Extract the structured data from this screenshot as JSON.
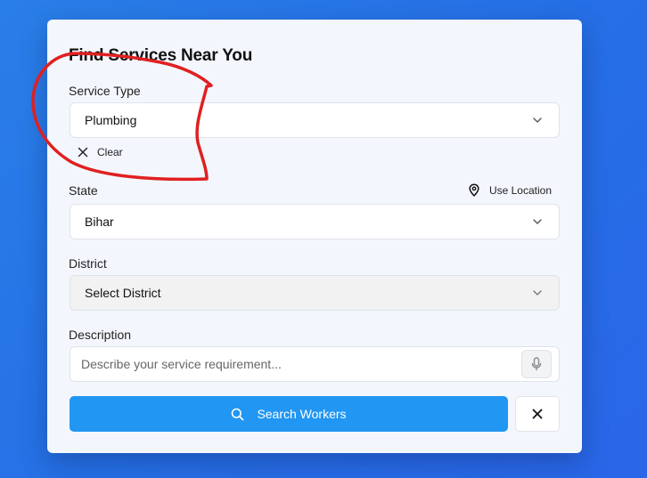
{
  "form": {
    "title": "Find Services Near You",
    "service_type": {
      "label": "Service Type",
      "value": "Plumbing",
      "clear_label": "Clear"
    },
    "state": {
      "label": "State",
      "value": "Bihar",
      "use_location_label": "Use Location"
    },
    "district": {
      "label": "District",
      "value": "Select District"
    },
    "description": {
      "label": "Description",
      "placeholder": "Describe your service requirement..."
    },
    "search_button_label": "Search Workers"
  },
  "icons": {
    "chevron": "chevron-down-icon",
    "clear": "close-icon",
    "location": "map-pin-icon",
    "mic": "microphone-icon",
    "search": "search-icon",
    "close": "close-icon"
  },
  "colors": {
    "accent": "#2196f3",
    "background": "#2a7ee8",
    "annotation": "#e02020"
  }
}
